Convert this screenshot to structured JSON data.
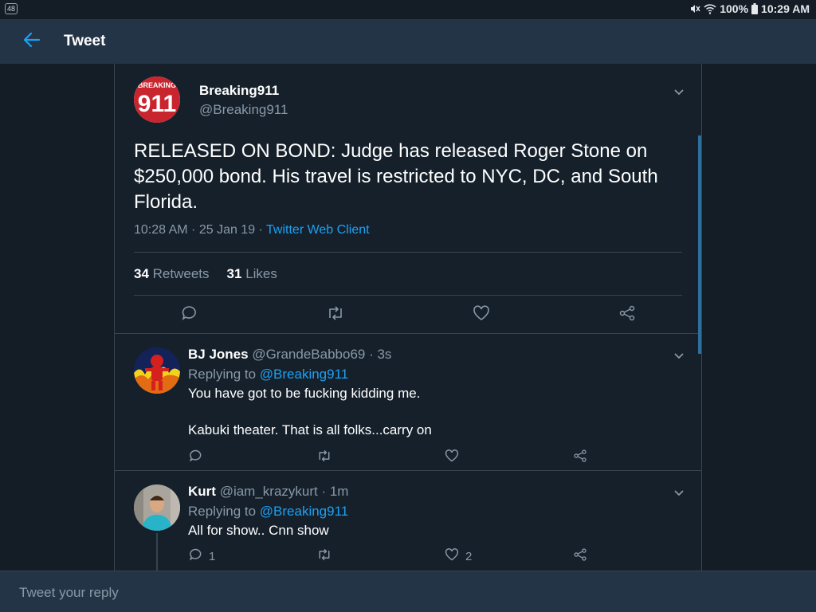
{
  "status_bar": {
    "badge": "48",
    "battery": "100%",
    "time": "10:29 AM"
  },
  "app_bar": {
    "title": "Tweet"
  },
  "main_tweet": {
    "avatar_text_top": "BREAKING",
    "avatar_text_big": "911",
    "name": "Breaking911",
    "handle": "@Breaking911",
    "text": "RELEASED ON BOND: Judge has released Roger Stone on $250,000 bond. His travel is restricted to NYC, DC, and South Florida.",
    "timestamp": "10:28 AM · 25 Jan 19 · ",
    "client": "Twitter Web Client",
    "retweet_count": "34",
    "retweet_label": "Retweets",
    "like_count": "31",
    "like_label": "Likes"
  },
  "replies": [
    {
      "name": "BJ Jones",
      "handle": "@GrandeBabbo69 · 3s",
      "replying_prefix": "Replying to ",
      "replying_to": "@Breaking911",
      "text_line1": "You have got to be fucking kidding me.",
      "text_line2": "Kabuki theater. That is all folks...carry on",
      "reply_count": "",
      "like_count": ""
    },
    {
      "name": "Kurt",
      "handle": "@iam_krazykurt · 1m",
      "replying_prefix": "Replying to ",
      "replying_to": "@Breaking911",
      "text_line1": "All for show.. Cnn show",
      "reply_count": "1",
      "like_count": "2"
    }
  ],
  "reply_box": {
    "placeholder": "Tweet your reply"
  },
  "colors": {
    "background": "#15202b",
    "app_bar": "#243447",
    "accent": "#1da1f2",
    "secondary_text": "#8899a6",
    "border": "#38444d"
  },
  "icons": [
    "back-arrow-icon",
    "chevron-down-icon",
    "reply-icon",
    "retweet-icon",
    "like-icon",
    "share-icon",
    "mute-icon",
    "wifi-icon",
    "battery-icon"
  ]
}
